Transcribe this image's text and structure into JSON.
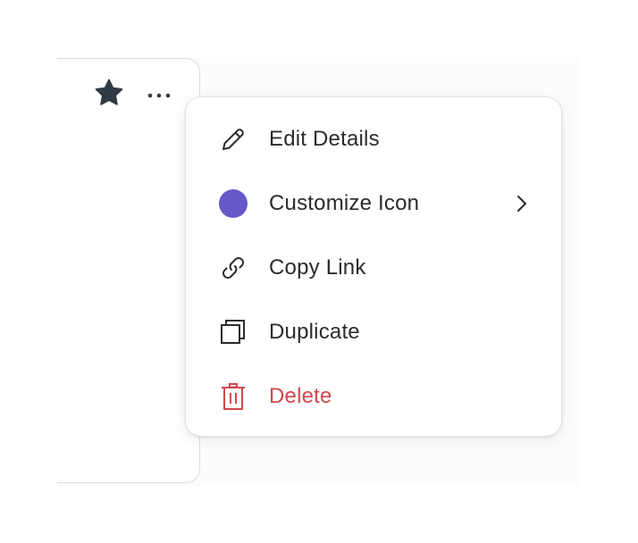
{
  "card": {
    "star_icon": "star-icon",
    "more_icon": "more-horizontal-icon"
  },
  "menu": {
    "items": [
      {
        "label": "Edit Details",
        "icon": "pencil-icon"
      },
      {
        "label": "Customize Icon",
        "icon": "color-dot-icon",
        "has_submenu": true
      },
      {
        "label": "Copy Link",
        "icon": "link-icon"
      },
      {
        "label": "Duplicate",
        "icon": "duplicate-icon"
      },
      {
        "label": "Delete",
        "icon": "trash-icon",
        "danger": true
      }
    ]
  },
  "colors": {
    "icon_color": "#6558c7",
    "danger": "#d2464c",
    "text": "#2b2b2b",
    "star": "#2f3a44"
  }
}
